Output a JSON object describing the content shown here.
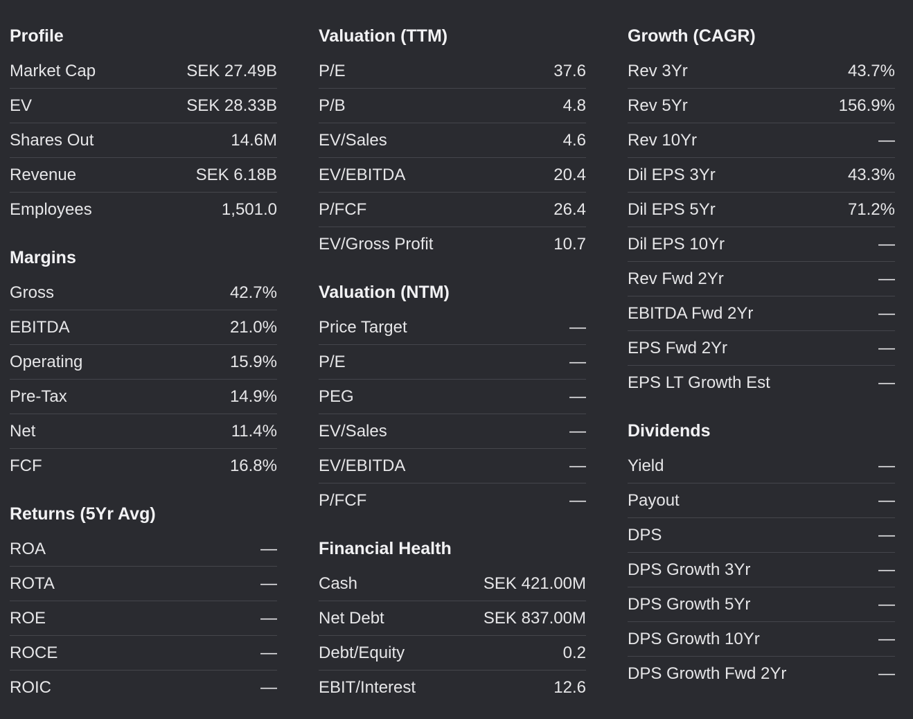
{
  "profile": {
    "title": "Profile",
    "rows": [
      {
        "label": "Market Cap",
        "value": "SEK 27.49B"
      },
      {
        "label": "EV",
        "value": "SEK 28.33B"
      },
      {
        "label": "Shares Out",
        "value": "14.6M"
      },
      {
        "label": "Revenue",
        "value": "SEK 6.18B"
      },
      {
        "label": "Employees",
        "value": "1,501.0"
      }
    ]
  },
  "margins": {
    "title": "Margins",
    "rows": [
      {
        "label": "Gross",
        "value": "42.7%"
      },
      {
        "label": "EBITDA",
        "value": "21.0%"
      },
      {
        "label": "Operating",
        "value": "15.9%"
      },
      {
        "label": "Pre-Tax",
        "value": "14.9%"
      },
      {
        "label": "Net",
        "value": "11.4%"
      },
      {
        "label": "FCF",
        "value": "16.8%"
      }
    ]
  },
  "returns": {
    "title": "Returns (5Yr Avg)",
    "rows": [
      {
        "label": "ROA",
        "value": "—"
      },
      {
        "label": "ROTA",
        "value": "—"
      },
      {
        "label": "ROE",
        "value": "—"
      },
      {
        "label": "ROCE",
        "value": "—"
      },
      {
        "label": "ROIC",
        "value": "—"
      }
    ]
  },
  "valuation_ttm": {
    "title": "Valuation (TTM)",
    "rows": [
      {
        "label": "P/E",
        "value": "37.6"
      },
      {
        "label": "P/B",
        "value": "4.8"
      },
      {
        "label": "EV/Sales",
        "value": "4.6"
      },
      {
        "label": "EV/EBITDA",
        "value": "20.4"
      },
      {
        "label": "P/FCF",
        "value": "26.4"
      },
      {
        "label": "EV/Gross Profit",
        "value": "10.7"
      }
    ]
  },
  "valuation_ntm": {
    "title": "Valuation (NTM)",
    "rows": [
      {
        "label": "Price Target",
        "value": "—"
      },
      {
        "label": "P/E",
        "value": "—"
      },
      {
        "label": "PEG",
        "value": "—"
      },
      {
        "label": "EV/Sales",
        "value": "—"
      },
      {
        "label": "EV/EBITDA",
        "value": "—"
      },
      {
        "label": "P/FCF",
        "value": "—"
      }
    ]
  },
  "financial_health": {
    "title": "Financial Health",
    "rows": [
      {
        "label": "Cash",
        "value": "SEK 421.00M"
      },
      {
        "label": "Net Debt",
        "value": "SEK 837.00M"
      },
      {
        "label": "Debt/Equity",
        "value": "0.2"
      },
      {
        "label": "EBIT/Interest",
        "value": "12.6"
      }
    ]
  },
  "growth": {
    "title": "Growth (CAGR)",
    "rows": [
      {
        "label": "Rev 3Yr",
        "value": "43.7%"
      },
      {
        "label": "Rev 5Yr",
        "value": "156.9%"
      },
      {
        "label": "Rev 10Yr",
        "value": "—"
      },
      {
        "label": "Dil EPS 3Yr",
        "value": "43.3%"
      },
      {
        "label": "Dil EPS 5Yr",
        "value": "71.2%"
      },
      {
        "label": "Dil EPS 10Yr",
        "value": "—"
      },
      {
        "label": "Rev Fwd 2Yr",
        "value": "—"
      },
      {
        "label": "EBITDA Fwd 2Yr",
        "value": "—"
      },
      {
        "label": "EPS Fwd 2Yr",
        "value": "—"
      },
      {
        "label": "EPS LT Growth Est",
        "value": "—"
      }
    ]
  },
  "dividends": {
    "title": "Dividends",
    "rows": [
      {
        "label": "Yield",
        "value": "—"
      },
      {
        "label": "Payout",
        "value": "—"
      },
      {
        "label": "DPS",
        "value": "—"
      },
      {
        "label": "DPS Growth 3Yr",
        "value": "—"
      },
      {
        "label": "DPS Growth 5Yr",
        "value": "—"
      },
      {
        "label": "DPS Growth 10Yr",
        "value": "—"
      },
      {
        "label": "DPS Growth Fwd 2Yr",
        "value": "—"
      }
    ]
  }
}
